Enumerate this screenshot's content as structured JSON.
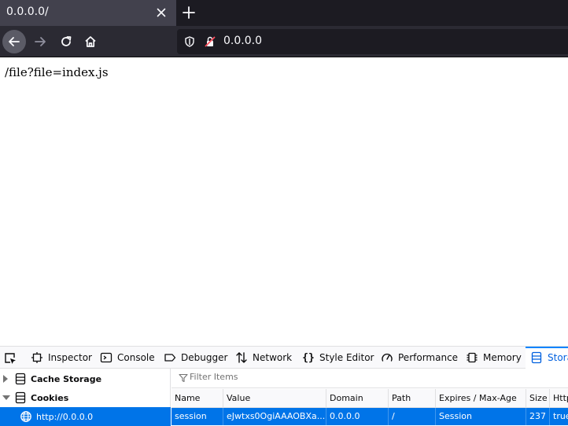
{
  "browser": {
    "tab_title": "0.0.0.0/",
    "url": "0.0.0.0"
  },
  "page": {
    "text": "/file?file=index.js"
  },
  "devtools": {
    "tabs": [
      {
        "label": "Inspector",
        "icon": "inspector-icon"
      },
      {
        "label": "Console",
        "icon": "console-icon"
      },
      {
        "label": "Debugger",
        "icon": "debugger-icon"
      },
      {
        "label": "Network",
        "icon": "network-icon"
      },
      {
        "label": "Style Editor",
        "icon": "style-editor-icon"
      },
      {
        "label": "Performance",
        "icon": "performance-icon"
      },
      {
        "label": "Memory",
        "icon": "memory-icon"
      },
      {
        "label": "Storage",
        "icon": "storage-icon"
      }
    ],
    "active_tab": "Storage",
    "sidebar": {
      "items": [
        {
          "label": "Cache Storage"
        },
        {
          "label": "Cookies"
        },
        {
          "label": "http://0.0.0.0"
        }
      ]
    },
    "table": {
      "filter_placeholder": "Filter Items",
      "columns": [
        "Name",
        "Value",
        "Domain",
        "Path",
        "Expires / Max-Age",
        "Size",
        "HttpOnly"
      ],
      "rows": [
        {
          "name": "session",
          "value": "eJwtxs0OgiAAAOBXa...",
          "domain": "0.0.0.0",
          "path": "/",
          "expires": "Session",
          "size": "237",
          "httponly": "true"
        }
      ]
    }
  },
  "colors": {
    "accent": "#0074e8",
    "active_tab_text": "#0060df"
  }
}
